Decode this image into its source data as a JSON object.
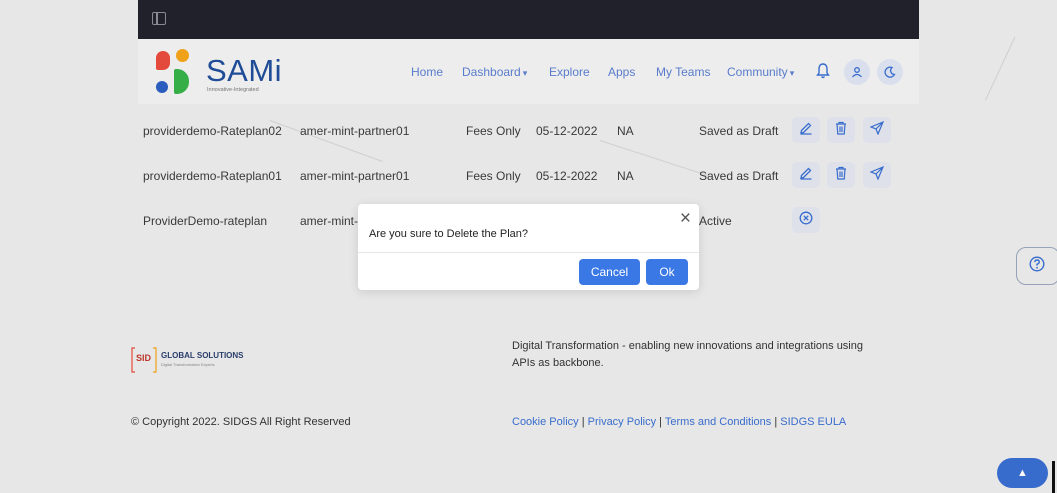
{
  "header": {
    "brand_name": "SAMi",
    "brand_tagline": "Innovative-Integrated",
    "nav": [
      {
        "label": "Home"
      },
      {
        "label": "Dashboard",
        "dropdown": true
      },
      {
        "label": "Explore"
      },
      {
        "label": "Apps"
      },
      {
        "label": "My Teams"
      },
      {
        "label": "Community",
        "dropdown": true
      }
    ],
    "icons": [
      "bell-icon",
      "user-icon",
      "moon-icon"
    ]
  },
  "table": {
    "rows": [
      {
        "name": "providerdemo-Rateplan02",
        "partner": "amer-mint-partner01",
        "type": "Fees Only",
        "date": "05-12-2022",
        "value": "NA",
        "status": "Saved as Draft",
        "actions": [
          "edit",
          "delete",
          "send"
        ]
      },
      {
        "name": "providerdemo-Rateplan01",
        "partner": "amer-mint-partner01",
        "type": "Fees Only",
        "date": "05-12-2022",
        "value": "NA",
        "status": "Saved as Draft",
        "actions": [
          "edit",
          "delete",
          "send"
        ]
      },
      {
        "name": "ProviderDemo-rateplan",
        "partner": "amer-mint-partner01",
        "type": "",
        "date": "",
        "value": "",
        "status": "Active",
        "actions": [
          "cancel"
        ]
      }
    ]
  },
  "dialog": {
    "message": "Are you sure to Delete the Plan?",
    "cancel_label": "Cancel",
    "ok_label": "Ok",
    "close_glyph": "×"
  },
  "footer": {
    "logo_left": "SID",
    "logo_right": "GLOBAL SOLUTIONS",
    "logo_sub": "Digital Transformation Experts",
    "description": "Digital Transformation - enabling new innovations and integrations using APIs as backbone.",
    "copyright": "© Copyright 2022. SIDGS All Right Reserved",
    "links": [
      "Cookie Policy",
      "Privacy Policy",
      "Terms and Conditions",
      "SIDGS EULA"
    ]
  },
  "colors": {
    "topbar": "#22222d",
    "accent": "#3a78e6",
    "nav_link": "#5b7fd0",
    "brand": "#1f4e9a"
  }
}
